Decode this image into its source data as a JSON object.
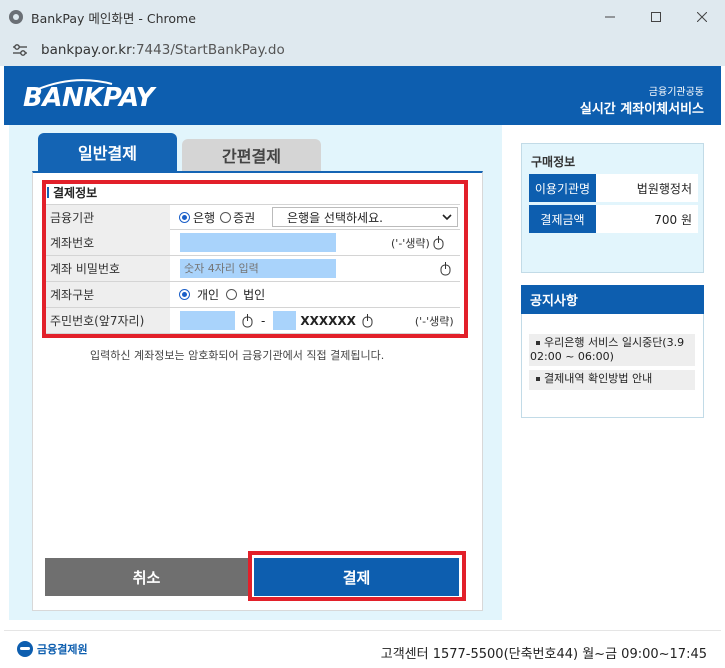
{
  "window": {
    "title": "BankPay 메인화면 - Chrome",
    "url_host": "bankpay.or.kr",
    "url_rest": ":7443/StartBankPay.do"
  },
  "header": {
    "logo": "BANKPAY",
    "subtitle": "금융기관공동",
    "main_title": "실시간 계좌이체서비스"
  },
  "tabs": [
    {
      "label": "일반결제",
      "active": true
    },
    {
      "label": "간편결제",
      "active": false
    }
  ],
  "form": {
    "section_title": "결제정보",
    "bank": {
      "label": "금융기관",
      "option_bank": "은행",
      "option_securities": "증권",
      "selected": "은행",
      "select_value": "은행을 선택하세요."
    },
    "account_number": {
      "label": "계좌번호",
      "value": "",
      "hint": "('-'생략)"
    },
    "account_password": {
      "label": "계좌 비밀번호",
      "placeholder": "숫자 4자리 입력"
    },
    "account_type": {
      "label": "계좌구분",
      "option_personal": "개인",
      "option_corporate": "법인",
      "selected": "개인"
    },
    "resident_number": {
      "label": "주민번호(앞7자리)",
      "separator": "-",
      "masked": "XXXXXX",
      "hint": "('-'생략)"
    },
    "notice": "입력하신 계좌정보는 암호화되어 금융기관에서 직접 결제됩니다."
  },
  "buttons": {
    "cancel": "취소",
    "pay": "결제"
  },
  "purchase_info": {
    "title": "구매정보",
    "merchant_label": "이용기관명",
    "merchant_value": "법원행정처",
    "amount_label": "결제금액",
    "amount_value": "700 원"
  },
  "notices": {
    "title": "공지사항",
    "items": [
      "우리은행 서비스 일시중단(3.9 02:00 ~ 06:00)",
      "결제내역 확인방법 안내"
    ]
  },
  "footer": {
    "org_name": "금융결제원",
    "contact": "고객센터 1577-5500(단축번호44)  월~금 09:00~17:45"
  },
  "colors": {
    "brand_blue": "#0d5eaf",
    "highlight_red": "#e2202a",
    "input_blue": "#a9d3fb"
  }
}
